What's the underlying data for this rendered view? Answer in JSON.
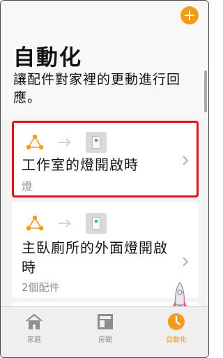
{
  "header": {
    "add_icon": "plus-icon",
    "accent_color": "#f39b1b",
    "title": "自動化",
    "subtitle": "讓配件對家裡的更動進行回應。"
  },
  "automations": [
    {
      "name": "工作室的燈開啟時",
      "detail": "燈",
      "trigger_icon": "people-triangle-icon",
      "accessory_icon": "light-switch-icon",
      "highlighted": true
    },
    {
      "name": "主臥廁所的外面燈開啟時",
      "detail": "2個配件",
      "trigger_icon": "people-triangle-icon",
      "accessory_icon": "light-switch-icon",
      "highlighted": false
    },
    {
      "name": "",
      "detail": "",
      "trigger_icon": "people-triangle-icon",
      "accessory_icon": "light-switch-icon",
      "highlighted": false
    }
  ],
  "tabbar": {
    "tabs": [
      {
        "label": "家庭",
        "icon": "house-icon",
        "selected": false
      },
      {
        "label": "房間",
        "icon": "room-icon",
        "selected": false
      },
      {
        "label": "自動化",
        "icon": "clock-icon",
        "selected": true
      }
    ]
  },
  "colors": {
    "highlight_border": "#e1121b",
    "status_green": "#3bc14a"
  }
}
